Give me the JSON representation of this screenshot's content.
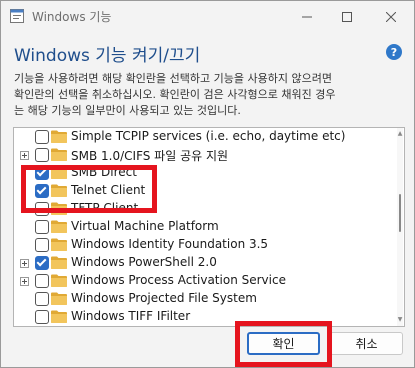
{
  "window": {
    "title": "Windows 기능",
    "heading": "Windows 기능 켜기/끄기",
    "description": "기능을 사용하려면 해당 확인란을 선택하고 기능을 사용하지 않으려면\n확인란의 선택을 취소하십시오. 확인란이 검은 사각형으로 채워진 경우\n는 해당 기능의 일부만이 사용되고 있는 것입니다."
  },
  "features": [
    {
      "label": "Simple TCPIP services (i.e. echo, daytime etc)",
      "checked": false,
      "expandable": false
    },
    {
      "label": "SMB 1.0/CIFS 파일 공유 지원",
      "checked": false,
      "expandable": true
    },
    {
      "label": "SMB Direct",
      "checked": true,
      "expandable": false
    },
    {
      "label": "Telnet Client",
      "checked": true,
      "expandable": false
    },
    {
      "label": "TFTP Client",
      "checked": false,
      "expandable": false
    },
    {
      "label": "Virtual Machine Platform",
      "checked": false,
      "expandable": false
    },
    {
      "label": "Windows Identity Foundation 3.5",
      "checked": false,
      "expandable": false
    },
    {
      "label": "Windows PowerShell 2.0",
      "checked": true,
      "expandable": true
    },
    {
      "label": "Windows Process Activation Service",
      "checked": false,
      "expandable": true
    },
    {
      "label": "Windows Projected File System",
      "checked": false,
      "expandable": false
    },
    {
      "label": "Windows TIFF IFilter",
      "checked": false,
      "expandable": false
    }
  ],
  "buttons": {
    "ok_label": "확인",
    "cancel_label": "취소"
  },
  "colors": {
    "highlight": "#e5141e",
    "accent": "#2b6cc4",
    "folder": "#f2c55c",
    "heading": "#1f4e8c"
  },
  "icons": {
    "minimize": "minimize-icon",
    "maximize": "maximize-icon",
    "close": "close-icon",
    "help": "help-icon",
    "folder": "folder-icon"
  }
}
